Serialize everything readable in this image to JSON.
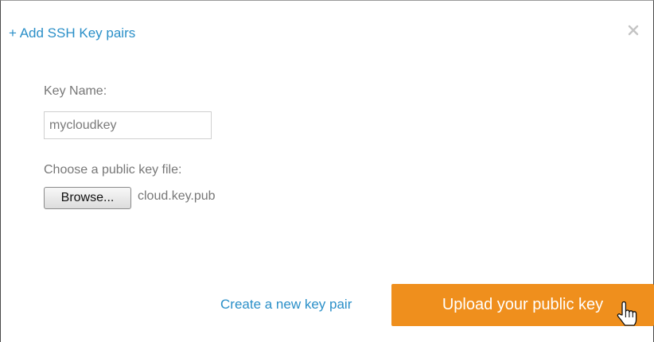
{
  "dialog": {
    "title": "+ Add SSH Key pairs",
    "close_icon": "close-icon"
  },
  "form": {
    "key_name_label": "Key Name:",
    "key_name_value": "mycloudkey",
    "key_file_label": "Choose a public key file:",
    "browse_label": "Browse...",
    "selected_file": "cloud.key.pub"
  },
  "actions": {
    "create_link": "Create a new key pair",
    "upload_label": "Upload your public key"
  },
  "colors": {
    "link": "#2a8fc8",
    "primary_button": "#ef8f1d",
    "label_text": "#777777"
  },
  "icons": {
    "pointer": "hand-pointer-icon"
  }
}
